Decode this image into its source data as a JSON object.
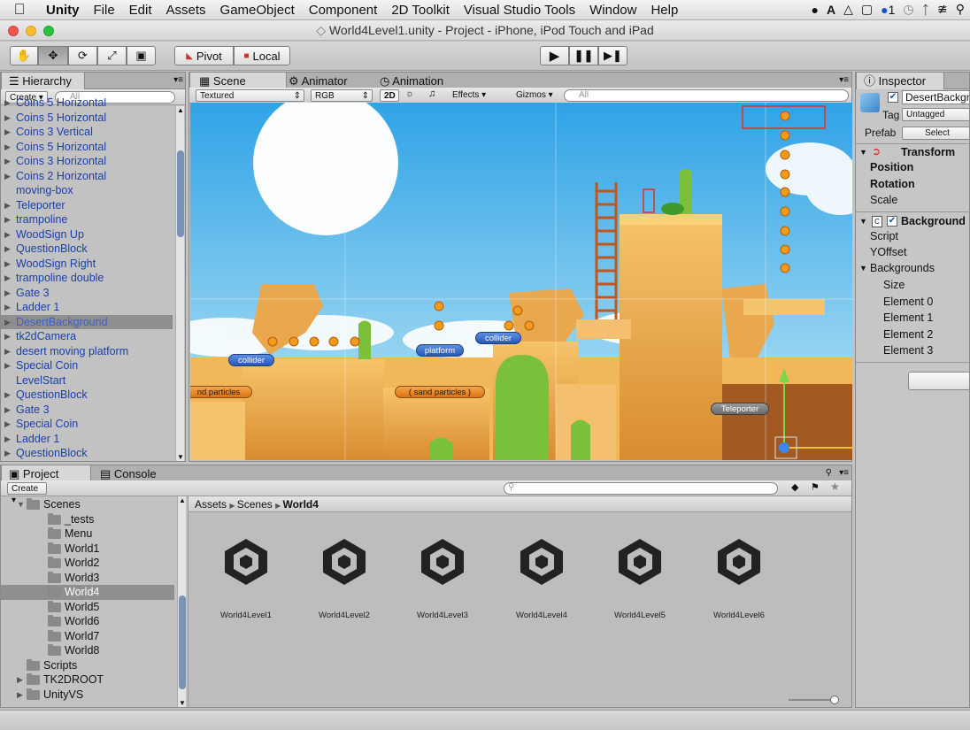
{
  "menubar": {
    "app": "Unity",
    "items": [
      "File",
      "Edit",
      "Assets",
      "GameObject",
      "Component",
      "2D Toolkit",
      "Visual Studio Tools",
      "Window",
      "Help"
    ],
    "badge": "1"
  },
  "window": {
    "title": "World4Level1.unity - Project - iPhone, iPod Touch and iPad"
  },
  "toolbar": {
    "pivot": "Pivot",
    "local": "Local"
  },
  "hierarchy": {
    "tab": "Hierarchy",
    "create": "Create",
    "search_placeholder": "All",
    "items": [
      {
        "label": "Coins 5 Horizontal",
        "arrow": true
      },
      {
        "label": "Coins 5 Horizontal",
        "arrow": true
      },
      {
        "label": "Coins 3 Vertical",
        "arrow": true
      },
      {
        "label": "Coins 5 Horizontal",
        "arrow": true
      },
      {
        "label": "Coins 3 Horizontal",
        "arrow": true
      },
      {
        "label": "Coins 2 Horizontal",
        "arrow": true
      },
      {
        "label": "moving-box",
        "arrow": false
      },
      {
        "label": "Teleporter",
        "arrow": true
      },
      {
        "label": "trampoline",
        "arrow": true
      },
      {
        "label": "WoodSign Up",
        "arrow": true
      },
      {
        "label": "QuestionBlock",
        "arrow": true
      },
      {
        "label": "WoodSign Right",
        "arrow": true
      },
      {
        "label": "trampoline double",
        "arrow": true
      },
      {
        "label": "Gate 3",
        "arrow": true
      },
      {
        "label": "Ladder 1",
        "arrow": true
      },
      {
        "label": "DesertBackground",
        "arrow": true,
        "selected": true
      },
      {
        "label": "tk2dCamera",
        "arrow": true
      },
      {
        "label": "desert moving platform",
        "arrow": true
      },
      {
        "label": "Special Coin",
        "arrow": true
      },
      {
        "label": "LevelStart",
        "arrow": false
      },
      {
        "label": "QuestionBlock",
        "arrow": true
      },
      {
        "label": "Gate 3",
        "arrow": true
      },
      {
        "label": "Special Coin",
        "arrow": true
      },
      {
        "label": "Ladder 1",
        "arrow": true
      },
      {
        "label": "QuestionBlock",
        "arrow": true
      }
    ]
  },
  "scene": {
    "tabs": {
      "scene": "Scene",
      "animator": "Animator",
      "animation": "Animation"
    },
    "shading": "Textured",
    "color": "RGB",
    "mode2d": "2D",
    "effects": "Effects",
    "gizmos": "Gizmos",
    "search_placeholder": "All",
    "labels": {
      "collider1": "collider",
      "platform": "platform",
      "collider2": "collider",
      "particles1": "nd particles",
      "particles2": "( sand particles )",
      "teleporter": "Teleporter"
    },
    "sky_color": "#4fb8ea",
    "sand_color": "#f1b85a"
  },
  "project": {
    "tabs": {
      "project": "Project",
      "console": "Console"
    },
    "create": "Create",
    "breadcrumb": [
      "Assets",
      "Scenes",
      "World4"
    ],
    "tree": [
      {
        "label": "Scenes",
        "depth": 1,
        "open": true
      },
      {
        "label": "_tests",
        "depth": 2
      },
      {
        "label": "Menu",
        "depth": 2
      },
      {
        "label": "World1",
        "depth": 2
      },
      {
        "label": "World2",
        "depth": 2
      },
      {
        "label": "World3",
        "depth": 2
      },
      {
        "label": "World4",
        "depth": 2,
        "selected": true
      },
      {
        "label": "World5",
        "depth": 2
      },
      {
        "label": "World6",
        "depth": 2
      },
      {
        "label": "World7",
        "depth": 2
      },
      {
        "label": "World8",
        "depth": 2
      },
      {
        "label": "Scripts",
        "depth": 1
      },
      {
        "label": "TK2DROOT",
        "depth": 1,
        "closed": true
      },
      {
        "label": "UnityVS",
        "depth": 1,
        "closed": true
      }
    ],
    "assets": [
      "World4Level1",
      "World4Level2",
      "World4Level3",
      "World4Level4",
      "World4Level5",
      "World4Level6"
    ]
  },
  "inspector": {
    "tab": "Inspector",
    "name": "DesertBackgr",
    "tag_label": "Tag",
    "tag_value": "Untagged",
    "prefab_label": "Prefab",
    "select": "Select",
    "transform": "Transform",
    "position": "Position",
    "rotation": "Rotation",
    "scale": "Scale",
    "component": "Background P",
    "script": "Script",
    "yoffset": "YOffset",
    "backgrounds": "Backgrounds",
    "size": "Size",
    "elements": [
      "Element 0",
      "Element 1",
      "Element 2",
      "Element 3"
    ]
  }
}
